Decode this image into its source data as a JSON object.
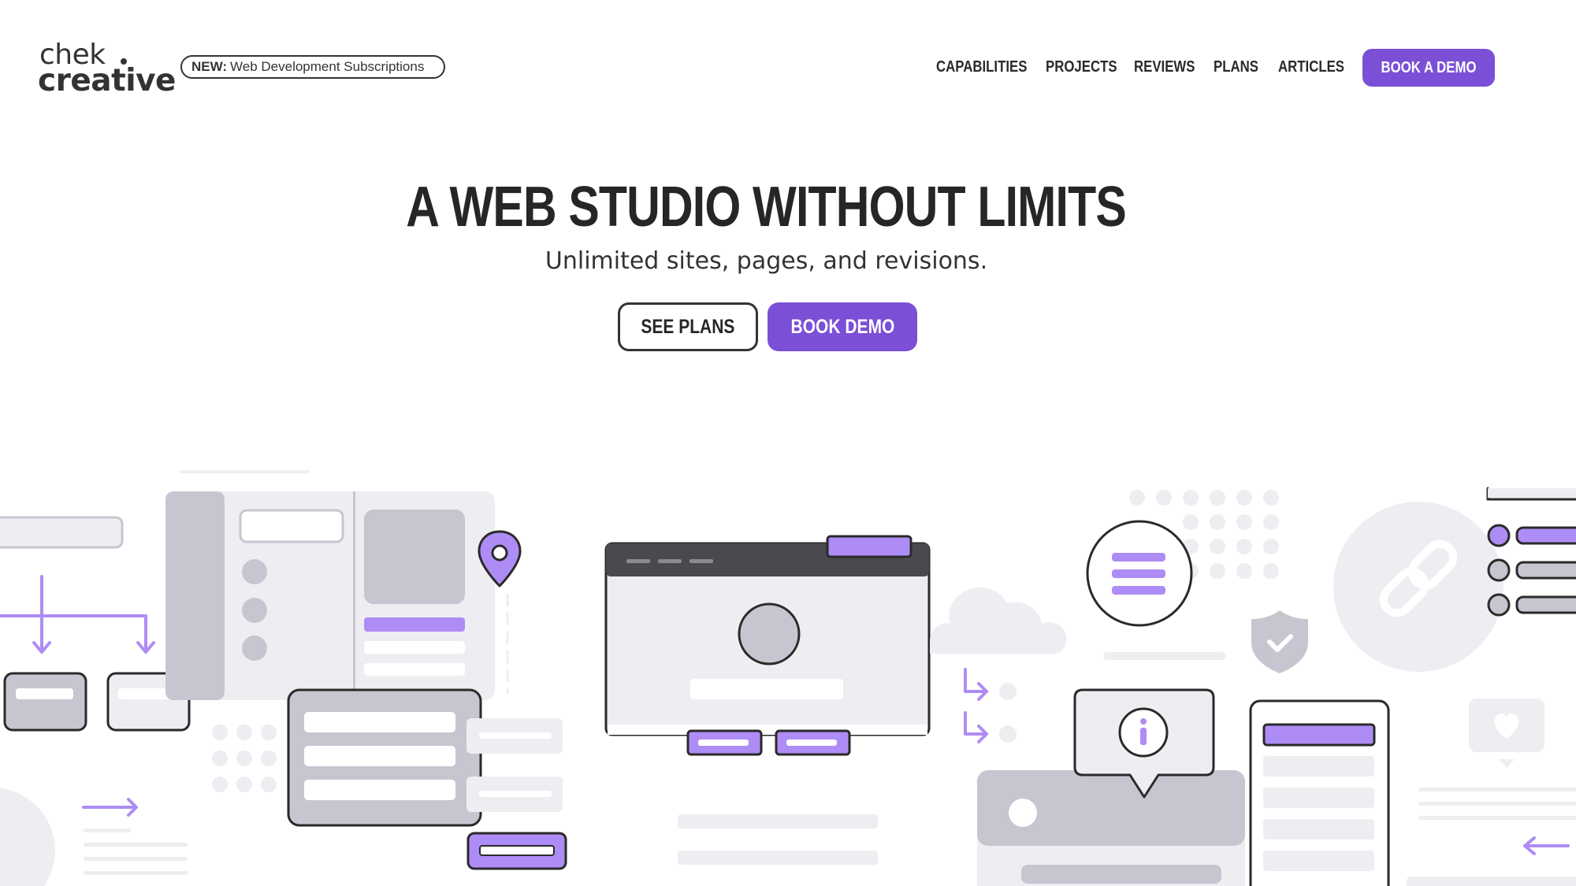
{
  "brand": {
    "logo_line1": "chek",
    "logo_line2": "creative"
  },
  "announcement": {
    "tag": "NEW:",
    "text": "Web Development Subscriptions"
  },
  "nav": {
    "items": [
      "CAPABILITIES",
      "PROJECTS",
      "REVIEWS",
      "PLANS",
      "ARTICLES"
    ],
    "cta": "BOOK A DEMO"
  },
  "hero": {
    "title": "A WEB STUDIO WITHOUT LIMITS",
    "subtitle": "Unlimited sites, pages, and revisions.",
    "secondary_button": "SEE PLANS",
    "primary_button": "BOOK DEMO"
  },
  "colors": {
    "accent": "#7b4fd6",
    "illustration_purple": "#ae8cf5",
    "illustration_gray": "#c6c6d0",
    "illustration_light": "#eeeef2",
    "ink": "#2a2a2a"
  },
  "icons": [
    "location-pin-icon",
    "menu-icon",
    "shield-check-icon",
    "link-icon",
    "info-icon",
    "heart-icon",
    "cloud-icon",
    "arrow-right-icon",
    "arrow-left-icon"
  ]
}
